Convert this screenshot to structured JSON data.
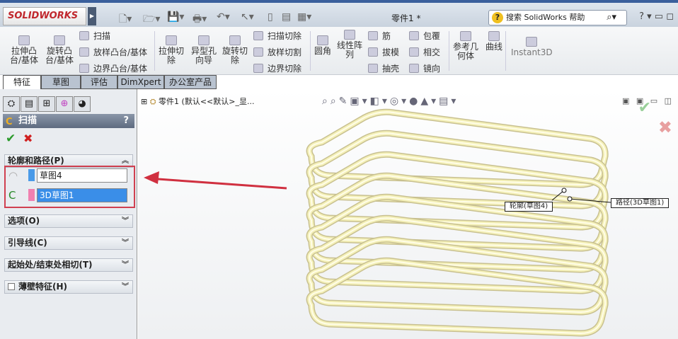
{
  "app": {
    "logo": "SOLIDWORKS",
    "document_title": "零件1 *",
    "search_placeholder": "搜索 SolidWorks 帮助"
  },
  "ribbon": {
    "large": [
      "拉伸凸\n台/基体",
      "旋转凸\n台/基体",
      "拉伸切\n除",
      "异型孔\n向导",
      "旋转切\n除",
      "圆角",
      "线性阵\n列",
      "参考几\n何体",
      "曲线",
      "Instant3D"
    ],
    "small": [
      "扫描",
      "放样凸台/基体",
      "边界凸台/基体",
      "扫描切除",
      "放样切割",
      "边界切除",
      "筋",
      "拔模",
      "抽壳",
      "包覆",
      "相交",
      "镜向"
    ]
  },
  "tabs": [
    "特征",
    "草图",
    "评估",
    "DimXpert",
    "办公室产品"
  ],
  "panel": {
    "title": "扫描",
    "help": "?",
    "groups": {
      "profile_path": "轮廓和路径(P)",
      "options": "选项(O)",
      "guides": "引导线(C)",
      "tangency": "起始处/结束处相切(T)",
      "thin": "薄壁特征(H)"
    },
    "profile_value": "草图4",
    "path_value": "3D草图1",
    "profile_color": "#4a9ae8",
    "path_color": "#f080b0"
  },
  "view": {
    "tree_item": "零件1 (默认<<默认>_显...",
    "callout_profile": "轮廓(草图4)",
    "callout_path": "路径(3D草图1)"
  }
}
